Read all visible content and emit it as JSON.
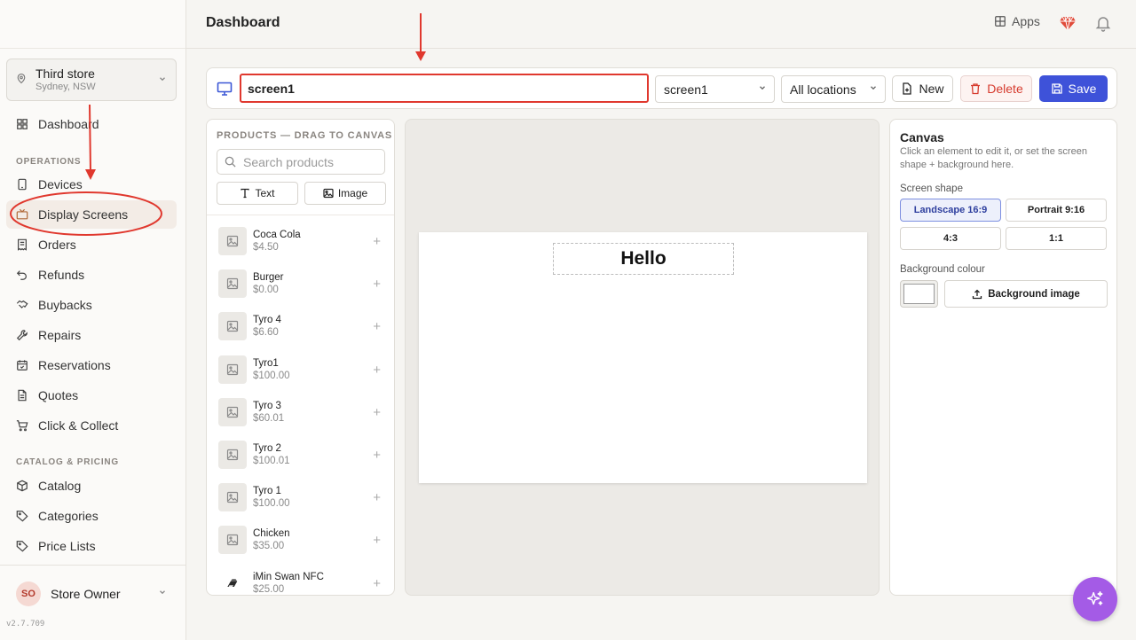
{
  "store": {
    "name": "Third store",
    "location": "Sydney, NSW"
  },
  "nav": {
    "top": {
      "label": "Dashboard",
      "icon": "layout-grid-icon"
    },
    "sections": [
      {
        "title": "OPERATIONS",
        "items": [
          {
            "label": "Devices",
            "icon": "tablet-icon"
          },
          {
            "label": "Display Screens",
            "icon": "tv-icon",
            "active": true
          },
          {
            "label": "Orders",
            "icon": "receipt-icon"
          },
          {
            "label": "Refunds",
            "icon": "undo-icon"
          },
          {
            "label": "Buybacks",
            "icon": "handshake-icon"
          },
          {
            "label": "Repairs",
            "icon": "wrench-icon"
          },
          {
            "label": "Reservations",
            "icon": "calendar-icon"
          },
          {
            "label": "Quotes",
            "icon": "document-icon"
          },
          {
            "label": "Click & Collect",
            "icon": "cart-icon"
          }
        ]
      },
      {
        "title": "CATALOG & PRICING",
        "items": [
          {
            "label": "Catalog",
            "icon": "box-icon"
          },
          {
            "label": "Categories",
            "icon": "tag-icon"
          },
          {
            "label": "Price Lists",
            "icon": "tag-icon"
          }
        ]
      }
    ]
  },
  "user": {
    "initials": "SO",
    "name": "Store Owner"
  },
  "version": "v2.7.709",
  "header": {
    "title": "Dashboard",
    "apps_label": "Apps"
  },
  "toolbar": {
    "screen_name_value": "screen1",
    "screen_select": "screen1",
    "location_select": "All locations",
    "new_label": "New",
    "delete_label": "Delete",
    "save_label": "Save"
  },
  "products": {
    "heading": "PRODUCTS — DRAG TO CANVAS",
    "search_placeholder": "Search products",
    "text_btn": "Text",
    "image_btn": "Image",
    "items": [
      {
        "name": "Coca Cola",
        "price": "$4.50"
      },
      {
        "name": "Burger",
        "price": "$0.00"
      },
      {
        "name": "Tyro 4",
        "price": "$6.60"
      },
      {
        "name": "Tyro1",
        "price": "$100.00"
      },
      {
        "name": "Tyro 3",
        "price": "$60.01"
      },
      {
        "name": "Tyro 2",
        "price": "$100.01"
      },
      {
        "name": "Tyro 1",
        "price": "$100.00"
      },
      {
        "name": "Chicken",
        "price": "$35.00"
      },
      {
        "name": "iMin Swan NFC",
        "price": "$25.00"
      }
    ]
  },
  "canvas": {
    "text_element": "Hello"
  },
  "inspector": {
    "title": "Canvas",
    "description": "Click an element to edit it, or set the screen shape + background here.",
    "shape_label": "Screen shape",
    "shapes": [
      "Landscape 16:9",
      "Portrait 9:16",
      "4:3",
      "1:1"
    ],
    "active_shape": "Landscape 16:9",
    "bg_label": "Background colour",
    "bg_color": "#ffffff",
    "bg_image_btn": "Background image"
  },
  "colors": {
    "accent": "#3e52d9",
    "danger": "#d63b2e",
    "annotation": "#e0382e",
    "fab": "#a45be6"
  }
}
